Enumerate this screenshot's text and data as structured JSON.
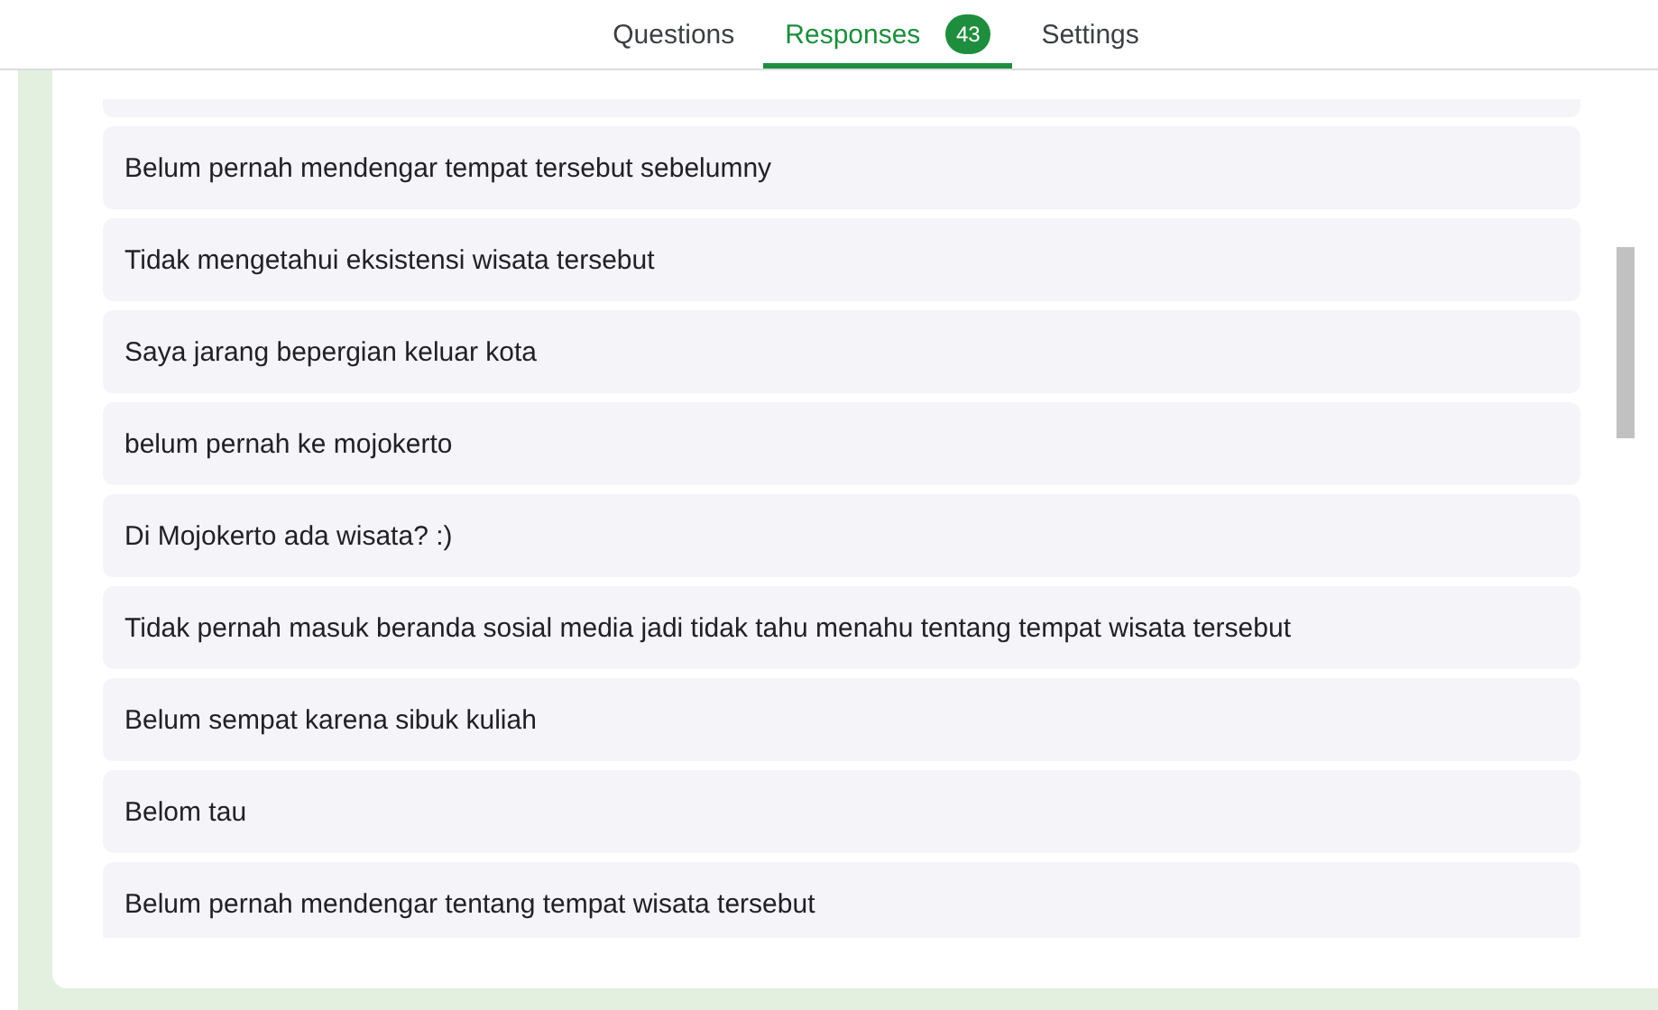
{
  "tabs": [
    {
      "label": "Questions",
      "selected": false
    },
    {
      "label": "Responses",
      "selected": true,
      "badge": "43"
    },
    {
      "label": "Settings",
      "selected": false
    }
  ],
  "responses": [
    "Belum pernah mendengar tempat tersebut sebelumny",
    "Tidak mengetahui eksistensi wisata tersebut",
    "Saya jarang bepergian keluar kota",
    "belum pernah ke mojokerto",
    "Di Mojokerto ada wisata? :)",
    "Tidak pernah masuk beranda sosial media jadi tidak tahu menahu tentang tempat wisata tersebut",
    "Belum sempat karena sibuk kuliah",
    "Belom tau",
    "Belum pernah mendengar tentang tempat wisata tersebut"
  ]
}
